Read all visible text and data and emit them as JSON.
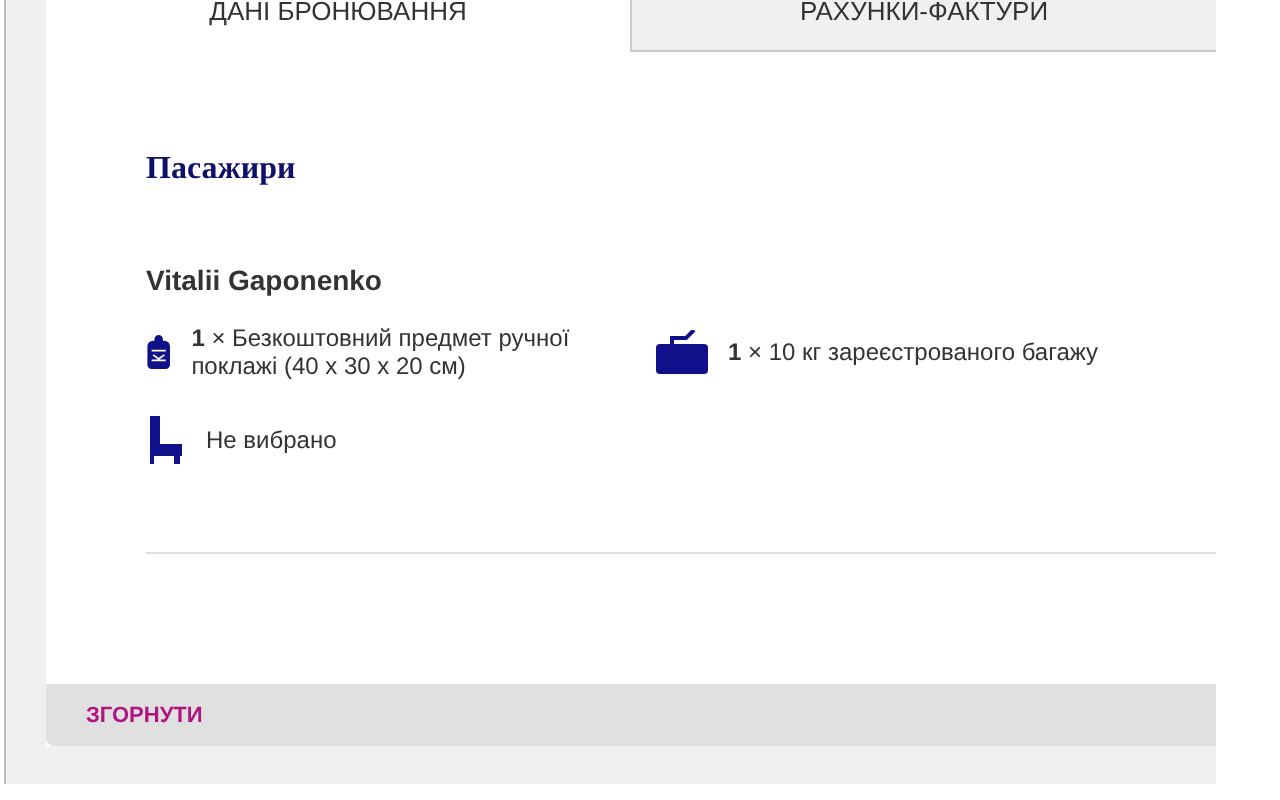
{
  "tabs": [
    {
      "label": "ДАНІ БРОНЮВАННЯ",
      "selected": true
    },
    {
      "label": "РАХУНКИ-ФАКТУРИ",
      "selected": false
    }
  ],
  "section_title": "Пасажири",
  "passenger": {
    "name": "Vitalii Gaponenko",
    "baggage": [
      {
        "kind": "cabin",
        "text": "**1** × Безкоштовний предмет ручної поклажі (40 x 30 x 20 см)"
      },
      {
        "kind": "checked",
        "text": "**1** × 10 кг зареєстрованого багажу"
      }
    ],
    "seat": {
      "kind": "seat",
      "text": "Не вибрано"
    }
  },
  "collapse_link": "ЗГОРНУТИ"
}
